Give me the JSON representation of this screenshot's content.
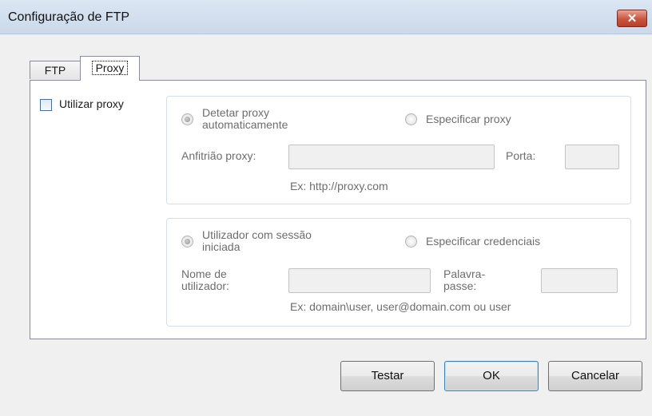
{
  "window": {
    "title": "Configuração de FTP",
    "close_glyph": "✕"
  },
  "tabs": [
    {
      "label": "FTP",
      "selected": false
    },
    {
      "label": "Proxy",
      "selected": true
    }
  ],
  "proxy": {
    "use_proxy_label": "Utilizar proxy",
    "use_proxy_checked": false,
    "server_group": {
      "detect_label": "Detetar proxy\nautomaticamente",
      "detect_checked": true,
      "specify_label": "Especificar proxy",
      "specify_checked": false,
      "host_label": "Anfitrião proxy:",
      "host_value": "",
      "port_label": "Porta:",
      "port_value": "",
      "example": "Ex: http://proxy.com"
    },
    "auth_group": {
      "logged_user_label": "Utilizador com sessão\niniciada",
      "logged_user_checked": true,
      "credentials_label": "Especificar credenciais",
      "credentials_checked": false,
      "username_label": "Nome de\nutilizador:",
      "username_value": "",
      "password_label": "Palavra-\npasse:",
      "password_value": "",
      "example": "Ex: domain\\user, user@domain.com ou user"
    }
  },
  "buttons": {
    "test": "Testar",
    "ok": "OK",
    "cancel": "Cancelar"
  },
  "colors": {
    "titlebar": "#cbd9ea",
    "close_button": "#c8553e",
    "panel_background": "#ffffff",
    "dialog_background": "#f0f0f0"
  }
}
